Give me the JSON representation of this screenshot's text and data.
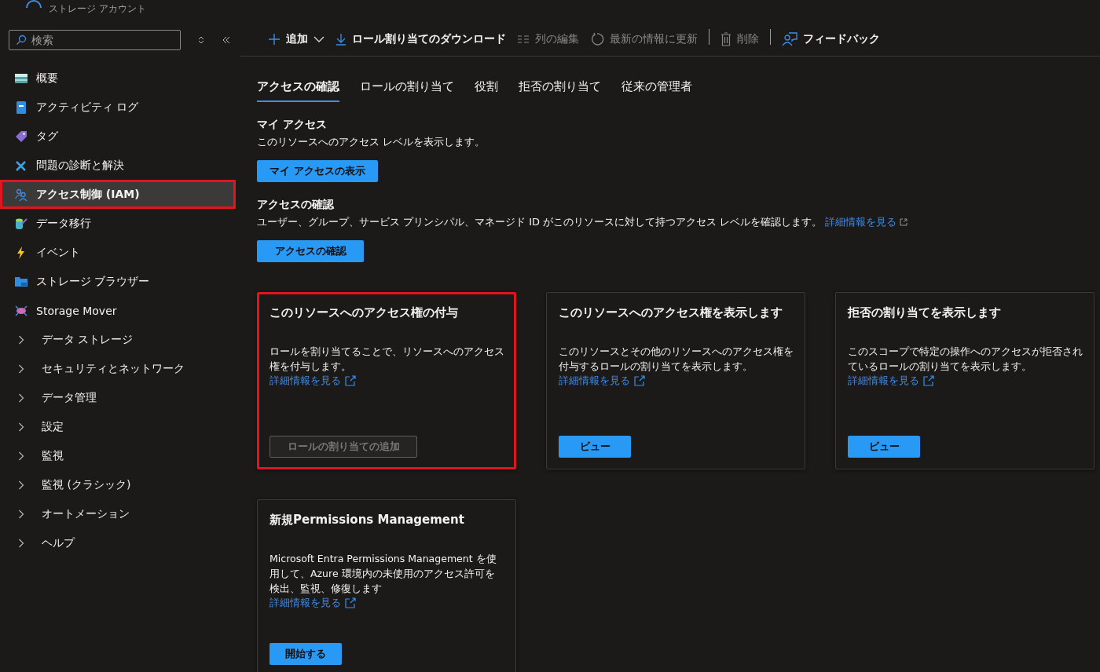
{
  "header": {
    "title": "ストレージ アカウント"
  },
  "sidebar": {
    "search": {
      "placeholder": "検索"
    },
    "items": [
      {
        "label": "概要",
        "kind": "icon",
        "selected": false,
        "highlighted": false
      },
      {
        "label": "アクティビティ ログ",
        "kind": "icon",
        "selected": false,
        "highlighted": false
      },
      {
        "label": "タグ",
        "kind": "icon",
        "selected": false,
        "highlighted": false
      },
      {
        "label": "問題の診断と解決",
        "kind": "icon",
        "selected": false,
        "highlighted": false
      },
      {
        "label": "アクセス制御 (IAM)",
        "kind": "icon",
        "selected": true,
        "highlighted": true
      },
      {
        "label": "データ移行",
        "kind": "icon",
        "selected": false,
        "highlighted": false
      },
      {
        "label": "イベント",
        "kind": "icon",
        "selected": false,
        "highlighted": false
      },
      {
        "label": "ストレージ ブラウザー",
        "kind": "icon",
        "selected": false,
        "highlighted": false
      },
      {
        "label": "Storage Mover",
        "kind": "icon",
        "selected": false,
        "highlighted": false
      },
      {
        "label": "データ ストレージ",
        "kind": "group",
        "selected": false,
        "highlighted": false
      },
      {
        "label": "セキュリティとネットワーク",
        "kind": "group",
        "selected": false,
        "highlighted": false
      },
      {
        "label": "データ管理",
        "kind": "group",
        "selected": false,
        "highlighted": false
      },
      {
        "label": "設定",
        "kind": "group",
        "selected": false,
        "highlighted": false
      },
      {
        "label": "監視",
        "kind": "group",
        "selected": false,
        "highlighted": false
      },
      {
        "label": "監視 (クラシック)",
        "kind": "group",
        "selected": false,
        "highlighted": false
      },
      {
        "label": "オートメーション",
        "kind": "group",
        "selected": false,
        "highlighted": false
      },
      {
        "label": "ヘルプ",
        "kind": "group",
        "selected": false,
        "highlighted": false
      }
    ]
  },
  "toolbar": [
    {
      "label": "追加",
      "kind": "add",
      "disabled": false
    },
    {
      "label": "ロール割り当てのダウンロード",
      "kind": "download",
      "disabled": false
    },
    {
      "label": "列の編集",
      "kind": "columns",
      "disabled": true
    },
    {
      "label": "最新の情報に更新",
      "kind": "refresh",
      "disabled": true
    },
    {
      "label": "削除",
      "kind": "delete",
      "disabled": true
    },
    {
      "label": "フィードバック",
      "kind": "feedback",
      "disabled": false
    }
  ],
  "tabs": [
    {
      "label": "アクセスの確認",
      "selected": true
    },
    {
      "label": "ロールの割り当て",
      "selected": false
    },
    {
      "label": "役割",
      "selected": false
    },
    {
      "label": "拒否の割り当て",
      "selected": false
    },
    {
      "label": "従来の管理者",
      "selected": false
    }
  ],
  "sections": [
    {
      "title": "マイ アクセス",
      "text": "このリソースへのアクセス レベルを表示します。",
      "button": "マイ アクセスの表示"
    },
    {
      "title": "アクセスの確認",
      "text": "ユーザー、グループ、サービス プリンシパル、マネージド ID がこのリソースに対して持つアクセス レベルを確認します。",
      "link": "詳細情報を見る",
      "button": "アクセスの確認"
    }
  ],
  "cards": [
    {
      "title": "このリソースへのアクセス権の付与",
      "text": "ロールを割り当てることで、リソースへのアクセス権を付与します。",
      "link": "詳細情報を見る",
      "button": "ロールの割り当ての追加",
      "disabled": true,
      "highlighted": true
    },
    {
      "title": "このリソースへのアクセス権を表示します",
      "text": "このリソースとその他のリソースへのアクセス権を付与するロールの割り当てを表示します。",
      "link": "詳細情報を見る",
      "button": "ビュー",
      "disabled": false,
      "highlighted": false
    },
    {
      "title": "拒否の割り当てを表示します",
      "text": "このスコープで特定の操作へのアクセスが拒否されているロールの割り当てを表示します。",
      "link": "詳細情報を見る",
      "button": "ビュー",
      "disabled": false,
      "highlighted": false
    },
    {
      "title": "新規Permissions Management",
      "text": "Microsoft Entra Permissions Management を使用して、Azure 環境内の未使用のアクセス許可を検出、監視、修復します",
      "link": "詳細情報を見る",
      "button": "開始する",
      "disabled": false,
      "highlighted": false
    }
  ]
}
